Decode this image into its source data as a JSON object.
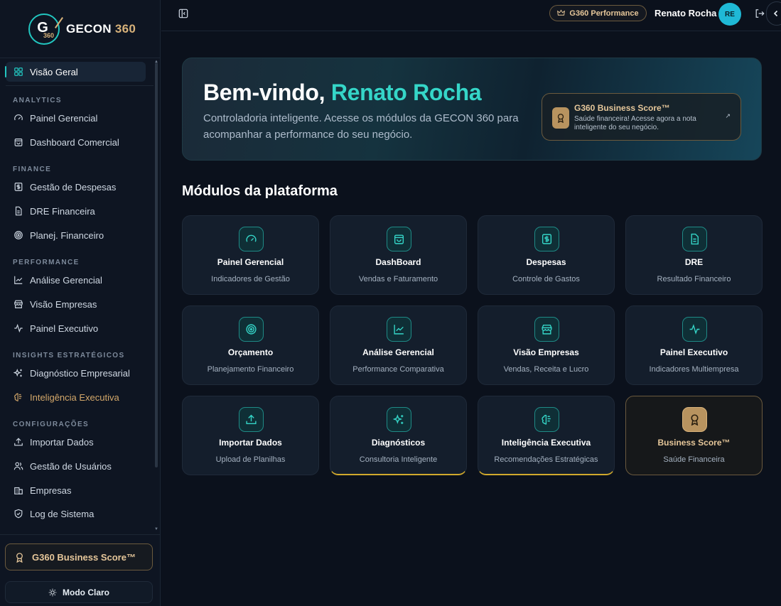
{
  "brand": {
    "name_part1": "GECON",
    "name_part2": " 360",
    "mark_letter": "G",
    "mark_number": "360"
  },
  "sidebar": {
    "items": [
      {
        "label": "Visão Geral",
        "icon": "grid-icon"
      },
      {
        "label": "Painel Gerencial",
        "icon": "gauge-icon"
      },
      {
        "label": "Dashboard Comercial",
        "icon": "bag-icon"
      },
      {
        "label": "Gestão de Despesas",
        "icon": "dollar-icon"
      },
      {
        "label": "DRE Financeira",
        "icon": "document-icon"
      },
      {
        "label": "Planej. Financeiro",
        "icon": "target-icon"
      },
      {
        "label": "Análise Gerencial",
        "icon": "chart-line-icon"
      },
      {
        "label": "Visão Empresas",
        "icon": "store-icon"
      },
      {
        "label": "Painel Executivo",
        "icon": "pulse-icon"
      },
      {
        "label": "Diagnóstico Empresarial",
        "icon": "sparkles-icon"
      },
      {
        "label": "Inteligência Executiva",
        "icon": "brain-icon"
      },
      {
        "label": "Importar Dados",
        "icon": "upload-icon"
      },
      {
        "label": "Gestão de Usuários",
        "icon": "users-icon"
      },
      {
        "label": "Empresas",
        "icon": "building-icon"
      },
      {
        "label": "Log de Sistema",
        "icon": "shield-icon"
      }
    ],
    "sections": {
      "analytics": "ANALYTICS",
      "finance": "FINANCE",
      "performance": "PERFORMANCE",
      "insights": "INSIGHTS ESTRATÉGICOS",
      "config": "CONFIGURAÇÕES"
    },
    "business_score_button": "G360 Business Score™",
    "mode_button": "Modo Claro"
  },
  "topbar": {
    "badge": "G360 Performance",
    "user_name": "Renato Rocha",
    "avatar_initials": "RE"
  },
  "hero": {
    "greeting": "Bem-vindo, ",
    "name": "Renato Rocha",
    "description": "Controladoria inteligente. Acesse os módulos da GECON 360 para acompanhar a performance do seu negócio.",
    "card_title": "G360 Business Score™",
    "card_desc": "Saúde financeira! Acesse agora a nota inteligente do seu negócio.",
    "card_arrow": "↗"
  },
  "modules": {
    "title": "Módulos da plataforma",
    "cards": [
      {
        "title": "Painel Gerencial",
        "subtitle": "Indicadores de Gestão"
      },
      {
        "title": "DashBoard",
        "subtitle": "Vendas e Faturamento"
      },
      {
        "title": "Despesas",
        "subtitle": "Controle de Gastos"
      },
      {
        "title": "DRE",
        "subtitle": "Resultado Financeiro"
      },
      {
        "title": "Orçamento",
        "subtitle": "Planejamento Financeiro"
      },
      {
        "title": "Análise Gerencial",
        "subtitle": "Performance Comparativa"
      },
      {
        "title": "Visão Empresas",
        "subtitle": "Vendas, Receita e Lucro"
      },
      {
        "title": "Painel Executivo",
        "subtitle": "Indicadores Multiempresa"
      },
      {
        "title": "Importar Dados",
        "subtitle": "Upload de Planilhas"
      },
      {
        "title": "Diagnósticos",
        "subtitle": "Consultoria Inteligente"
      },
      {
        "title": "Inteligência Executiva",
        "subtitle": "Recomendações Estratégicas"
      },
      {
        "title": "Business Score™",
        "subtitle": "Saúde Financeira"
      }
    ]
  },
  "colors": {
    "accent": "#22c6c0",
    "gold": "#d8b27a",
    "background": "#0b111c"
  }
}
